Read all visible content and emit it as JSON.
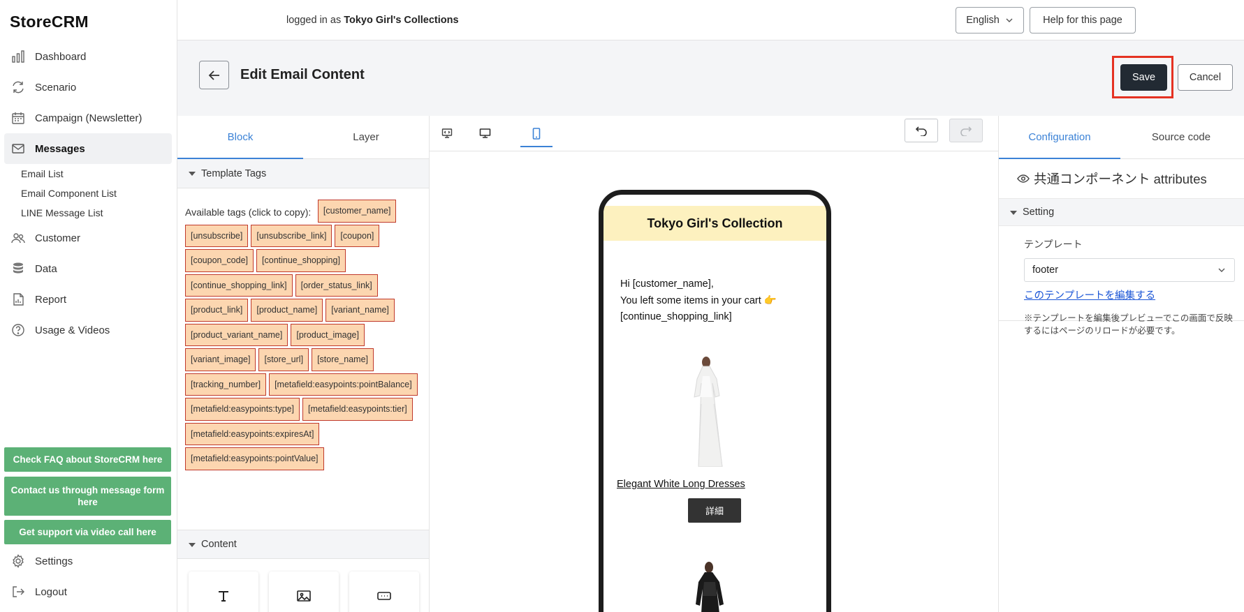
{
  "app": {
    "logo": "StoreCRM"
  },
  "sidebar": {
    "items": [
      {
        "label": "Dashboard",
        "icon": "bar-chart-icon"
      },
      {
        "label": "Scenario",
        "icon": "refresh-icon"
      },
      {
        "label": "Campaign (Newsletter)",
        "icon": "calendar-icon"
      },
      {
        "label": "Messages",
        "icon": "mail-icon",
        "active": true
      },
      {
        "label": "Customer",
        "icon": "users-icon"
      },
      {
        "label": "Data",
        "icon": "database-icon"
      },
      {
        "label": "Report",
        "icon": "report-icon"
      },
      {
        "label": "Usage & Videos",
        "icon": "help-icon"
      }
    ],
    "sub_items": [
      "Email List",
      "Email Component List",
      "LINE Message List"
    ],
    "support_buttons": [
      "Check FAQ about StoreCRM here",
      "Contact us through message form here",
      "Get support via video call here"
    ],
    "bottom_items": [
      {
        "label": "Settings",
        "icon": "gear-icon"
      },
      {
        "label": "Logout",
        "icon": "logout-icon"
      }
    ]
  },
  "topbar": {
    "logged_in_prefix": "logged in as",
    "store_name": "Tokyo Girl's Collections",
    "language": "English",
    "help": "Help for this page"
  },
  "header": {
    "title": "Edit Email Content",
    "save": "Save",
    "cancel": "Cancel"
  },
  "left_panel": {
    "tabs": [
      "Block",
      "Layer"
    ],
    "template_tags_title": "Template Tags",
    "available_label": "Available tags (click to copy):",
    "tags": [
      "[customer_name]",
      "[unsubscribe]",
      "[unsubscribe_link]",
      "[coupon]",
      "[coupon_code]",
      "[continue_shopping]",
      "[continue_shopping_link]",
      "[order_status_link]",
      "[product_link]",
      "[product_name]",
      "[variant_name]",
      "[product_variant_name]",
      "[product_image]",
      "[variant_image]",
      "[store_url]",
      "[store_name]",
      "[tracking_number]",
      "[metafield:easypoints:pointBalance]",
      "[metafield:easypoints:type]",
      "[metafield:easypoints:tier]",
      "[metafield:easypoints:expiresAt]",
      "[metafield:easypoints:pointValue]"
    ],
    "content_title": "Content"
  },
  "canvas": {
    "email_header": "Tokyo Girl's Collection",
    "greeting": "Hi [customer_name],",
    "line2": "You left some items in your cart 👉",
    "line3": "[continue_shopping_link]",
    "product_name": "Elegant White Long Dresses",
    "detail_button": "詳細"
  },
  "right_panel": {
    "tabs": [
      "Configuration",
      "Source code"
    ],
    "component_title": "共通コンポーネント attributes",
    "setting_title": "Setting",
    "template_label": "テンプレート",
    "template_value": "footer",
    "edit_link": "このテンプレートを編集する",
    "note": "※テンプレートを編集後プレビューでこの画面で反映するにはページのリロードが必要です。"
  },
  "colors": {
    "accent": "#3b82d6",
    "save_bg": "#222a33",
    "highlight": "#e53222",
    "support_green": "#5cb176",
    "tag_bg": "#fcd6b0",
    "email_header_bg": "#fdf1bf"
  }
}
